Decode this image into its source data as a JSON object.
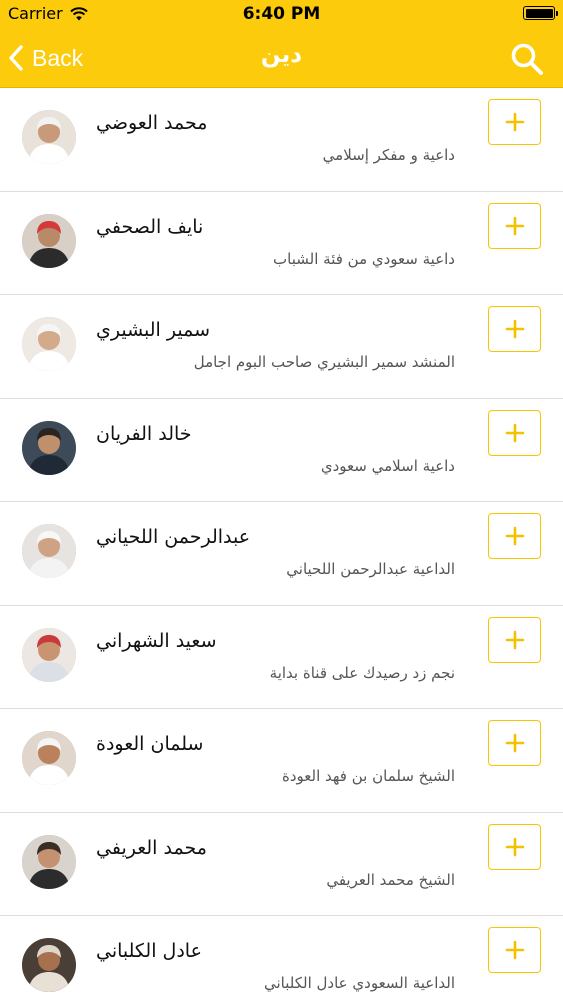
{
  "status_bar": {
    "carrier": "Carrier",
    "time": "6:40 PM",
    "battery_level": 1.0
  },
  "nav": {
    "back_label": "Back",
    "title": "دين",
    "back_icon": "chevron-left-icon",
    "search_icon": "search-icon"
  },
  "colors": {
    "accent": "#fccb0b",
    "button_border": "#f7c600",
    "plus": "#f2c100"
  },
  "list": {
    "items": [
      {
        "name": "محمد العوضي",
        "description": "داعية و مفكر إسلامي"
      },
      {
        "name": "نايف الصحفي",
        "description": "داعية سعودي من فئة الشباب"
      },
      {
        "name": "سمير البشيري",
        "description": "المنشد سمير البشيري صاحب البوم اجامل"
      },
      {
        "name": "خالد الفريان",
        "description": "داعية اسلامي سعودي"
      },
      {
        "name": "عبدالرحمن اللحياني",
        "description": "الداعية عبدالرحمن اللحياني"
      },
      {
        "name": "سعيد الشهراني",
        "description": "نجم زد رصيدك على قناة بداية"
      },
      {
        "name": "سلمان العودة",
        "description": "الشيخ سلمان بن فهد العودة"
      },
      {
        "name": "محمد العريفي",
        "description": "الشيخ محمد العريفي"
      },
      {
        "name": "عادل الكلباني",
        "description": "الداعية السعودي عادل الكلباني"
      }
    ],
    "add_icon": "plus-icon"
  }
}
